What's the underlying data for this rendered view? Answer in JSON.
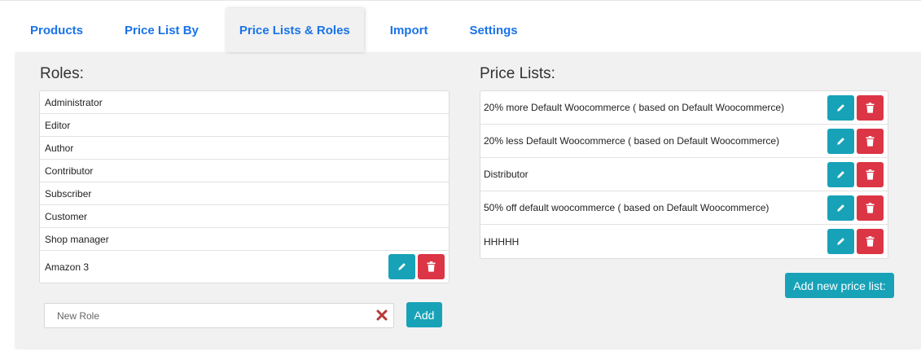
{
  "tabs": [
    {
      "label": "Products"
    },
    {
      "label": "Price List By"
    },
    {
      "label": "Price Lists & Roles"
    },
    {
      "label": "Import"
    },
    {
      "label": "Settings"
    }
  ],
  "active_tab": "Price Lists & Roles",
  "roles": {
    "title": "Roles:",
    "items": [
      {
        "label": "Administrator"
      },
      {
        "label": "Editor"
      },
      {
        "label": "Author"
      },
      {
        "label": "Contributor"
      },
      {
        "label": "Subscriber"
      },
      {
        "label": "Customer"
      },
      {
        "label": "Shop manager"
      },
      {
        "label": "Amazon 3"
      }
    ],
    "new_role_placeholder": "New Role",
    "add_label": "Add"
  },
  "price_lists": {
    "title": "Price Lists:",
    "items": [
      {
        "label": "20% more Default Woocommerce ( based on Default Woocommerce)"
      },
      {
        "label": "20% less Default Woocommerce ( based on Default Woocommerce)"
      },
      {
        "label": "Distributor"
      },
      {
        "label": "50% off default woocommerce ( based on Default Woocommerce)"
      },
      {
        "label": "HHHHH"
      }
    ],
    "add_label": "Add new price list:"
  },
  "icons": {
    "edit": "pencil-icon",
    "delete": "trash-icon",
    "clear": "close-x-icon"
  },
  "colors": {
    "tab_text": "#1a73e8",
    "edit_button": "#17a2b8",
    "delete_button": "#dc3545",
    "clear_x": "#b83a3a"
  }
}
